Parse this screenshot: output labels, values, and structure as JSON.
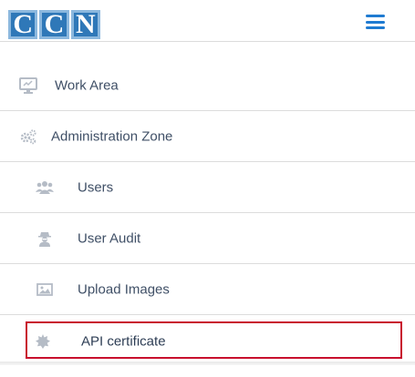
{
  "header": {
    "logo_letters": [
      "C",
      "C",
      "N"
    ],
    "menu_icon": "hamburger-menu-icon",
    "accent_color": "#1f7bd1"
  },
  "menu": {
    "items": [
      {
        "label": "Work Area",
        "icon": "monitor-icon",
        "level": 1
      },
      {
        "label": "Administration Zone",
        "icon": "cogs-icon",
        "level": 1
      },
      {
        "label": "Users",
        "icon": "users-icon",
        "level": 2
      },
      {
        "label": "User Audit",
        "icon": "user-secret-icon",
        "level": 2
      },
      {
        "label": "Upload Images",
        "icon": "image-icon",
        "level": 2
      },
      {
        "label": "API certificate",
        "icon": "certificate-icon",
        "level": 2,
        "highlighted": true
      }
    ],
    "highlight_color": "#c8102e",
    "icon_color": "#b5bcc6"
  }
}
